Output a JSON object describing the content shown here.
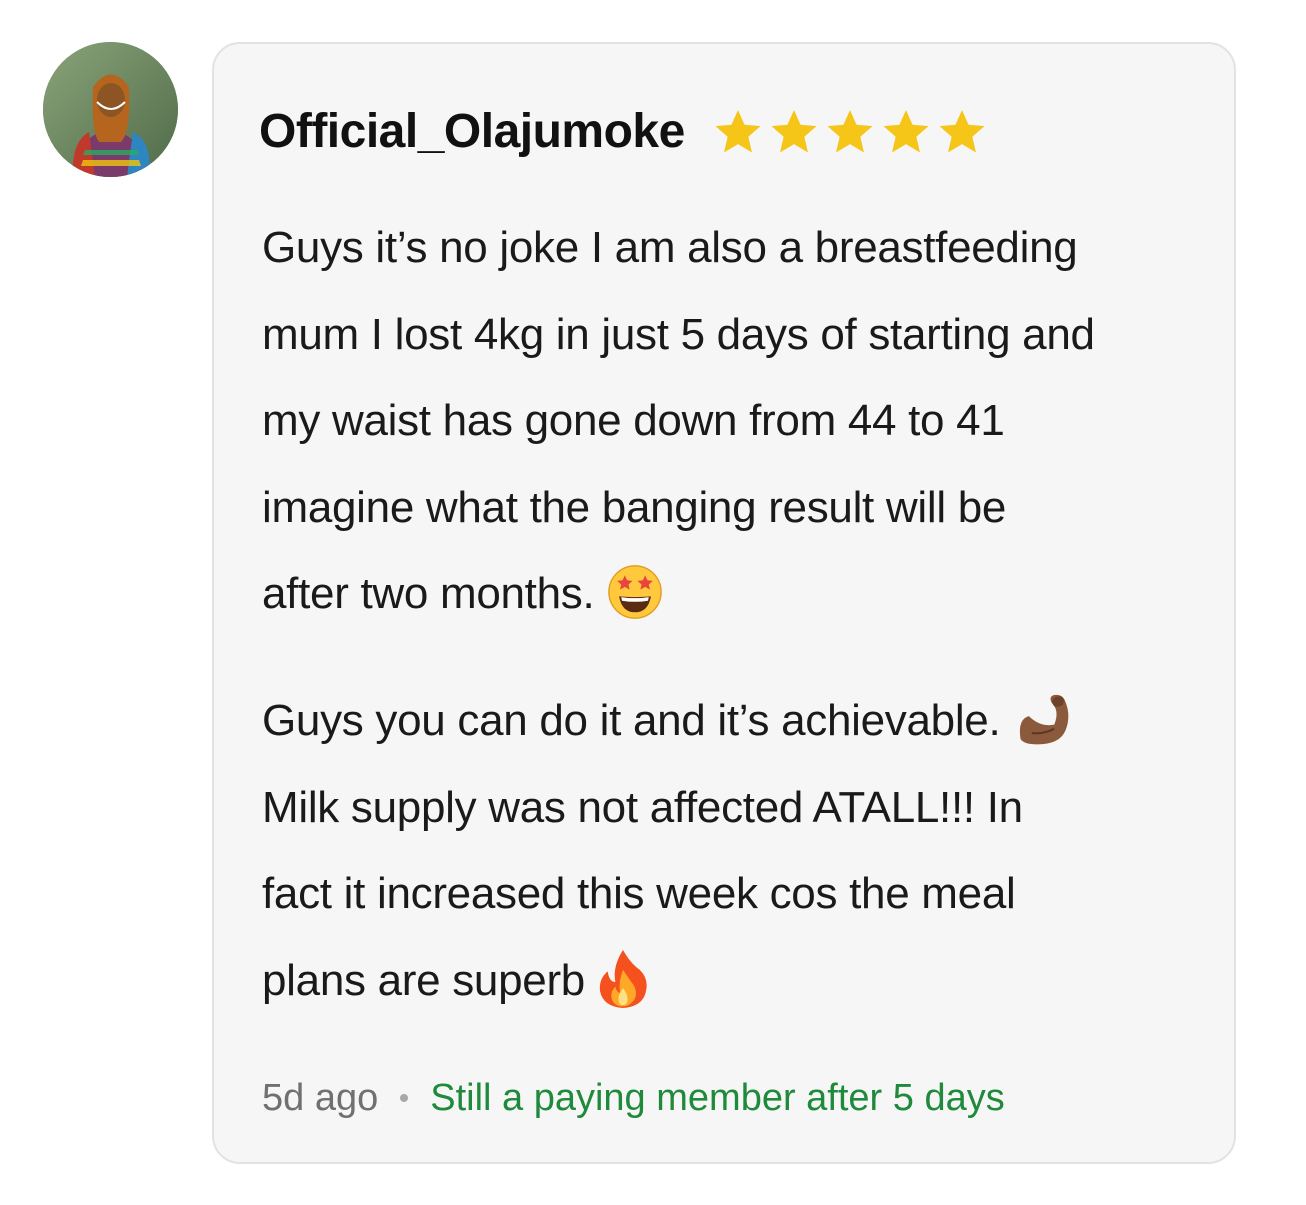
{
  "review": {
    "avatar_icon": "user-avatar-photo",
    "username": "Official_Olajumoke",
    "rating": 5,
    "rating_max": 5,
    "star_color": "#F5C518",
    "paragraph1_lines": [
      "Guys it’s no joke I am also a breastfeeding",
      "mum I lost 4kg in just 5 days of starting and",
      "my waist has gone down from 44 to 41",
      "imagine what the banging result will be",
      "after two months."
    ],
    "paragraph1_emoji": "star-struck-emoji",
    "paragraph2_lines": [
      "Guys you can do it and it’s achievable.",
      "Milk supply was not affected ATALL!!! In",
      "fact it increased this week cos the meal",
      "plans are superb"
    ],
    "paragraph2_emojis": [
      "flexed-biceps-emoji",
      "fire-emoji"
    ],
    "time_ago": "5d ago",
    "member_status": "Still a paying member after 5 days",
    "member_status_color": "#1F8A3B"
  }
}
